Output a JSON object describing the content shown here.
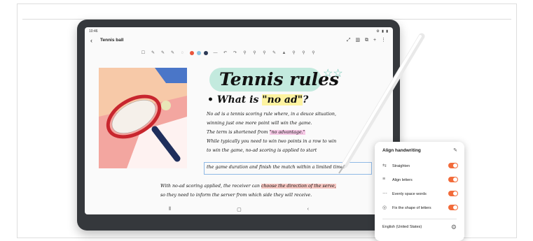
{
  "status_bar": {
    "time": "10:46",
    "system": "⚙ ▮ ▮"
  },
  "app_bar": {
    "title": "Tennis ball",
    "back": "‹"
  },
  "app_icons": [
    "⤢",
    "▥",
    "⧉",
    "+",
    "⋮"
  ],
  "toolbar": {
    "tools": [
      "☐",
      "✎",
      "✎",
      "✎",
      "◌"
    ],
    "colors": [
      "#e8553c",
      "#8cc7e3",
      "#2c3a56"
    ],
    "tools2": [
      "—",
      "↶",
      "↷",
      "⚲",
      "⚲",
      "⚲",
      "✎",
      "▲",
      "⚲",
      "⚲",
      "⚲"
    ]
  },
  "note": {
    "title": "Tennis rules",
    "stars": "☆☆",
    "subhead_prefix": "• What is ",
    "subhead_highlight": "\"no ad\"",
    "subhead_suffix": "?",
    "line1": "No ad is a tennis scoring rule where, in a deuce situation,",
    "line2": "winning just one more point will win the game.",
    "line3_prefix": "The term is shortened from ",
    "line3_highlight": "\"no advantage.\"",
    "line4": "While typically you need to win two points in a row to win",
    "line5": "to win the game, no-ad scoring is applied to start",
    "line6": "the game duration and finish the match within a limited time.",
    "line7_prefix": "With no-ad scoring applied, the receiver can ",
    "line7_highlight": "choose the direction of the serve,",
    "line8": "so they need to inform the server from which side they will receive."
  },
  "nav": {
    "recents": "⦀",
    "home": "▢",
    "back": "‹"
  },
  "panel": {
    "title": "Align handwriting",
    "pin": "✎",
    "options": [
      {
        "label": "Straighten",
        "icon": "⇆",
        "on": true
      },
      {
        "label": "Align letters",
        "icon": "≡",
        "on": true
      },
      {
        "label": "Evenly space words",
        "icon": "⋯",
        "on": true
      },
      {
        "label": "Fix the shape of letters",
        "icon": "◎",
        "on": true
      }
    ],
    "language": "English (United States)",
    "settings_icon": "⚙",
    "accent": "#f26b3a"
  }
}
